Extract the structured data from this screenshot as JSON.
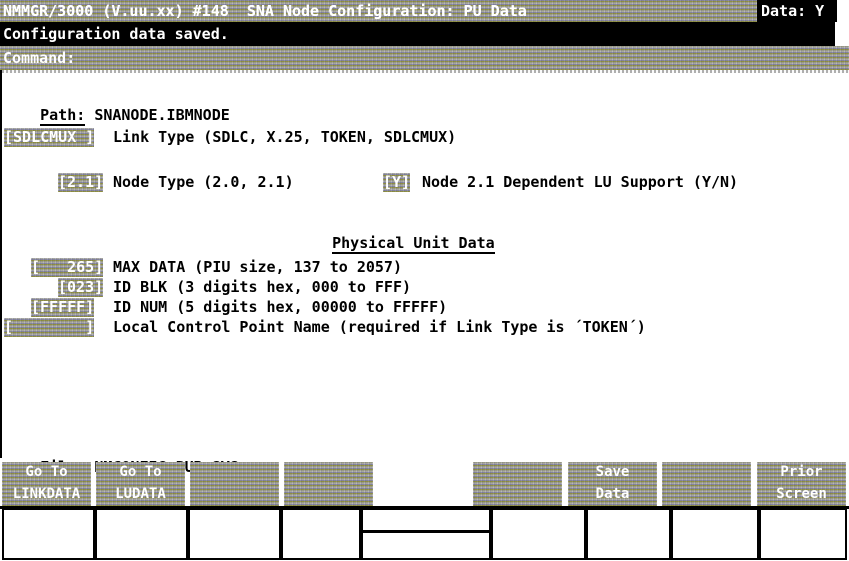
{
  "titlebar": {
    "text": "NMMGR/3000 (V.uu.xx) #148  SNA Node Configuration: PU Data",
    "data_indicator": "Data: Y"
  },
  "status": {
    "message": "Configuration data saved."
  },
  "command": {
    "label": "Command:",
    "value": ""
  },
  "path": {
    "label": "Path:",
    "value": "SNANODE.IBMNODE"
  },
  "form": {
    "link_type": {
      "field_value": "[SDLCMUX ]",
      "label": "Link Type (SDLC, X.25, TOKEN, SDLCMUX)"
    },
    "node_type": {
      "field_value": "[2.1]",
      "label": "Node Type (2.0, 2.1)"
    },
    "dependent_lu": {
      "field_value": "[Y]",
      "label": "Node 2.1 Dependent LU Support (Y/N)"
    },
    "section_heading": "Physical Unit Data",
    "max_data": {
      "field_value": "[   265]",
      "label": "MAX DATA (PIU size, 137 to 2057)"
    },
    "id_blk": {
      "field_value": "[023]",
      "label": "ID BLK (3 digits hex, 000 to FFF)"
    },
    "id_num": {
      "field_value": "[FFFFF]",
      "label": "ID NUM (5 digits hex, 00000 to FFFFF)"
    },
    "local_cp_name": {
      "field_value": "[        ]",
      "label": "Local Control Point Name (required if Link Type is ´TOKEN´)"
    }
  },
  "file": {
    "label": "File:",
    "value": "NMCONFIG.PUB.SYS"
  },
  "function_keys": [
    {
      "line1": "Go To",
      "line2": "LINKDATA"
    },
    {
      "line1": "Go To",
      "line2": "LUDATA"
    },
    {
      "line1": "",
      "line2": ""
    },
    {
      "line1": "",
      "line2": ""
    },
    {
      "line1": "",
      "line2": ""
    },
    {
      "line1": "Save",
      "line2": "Data"
    },
    {
      "line1": "",
      "line2": ""
    },
    {
      "line1": "Prior",
      "line2": "Screen"
    }
  ],
  "bottom_boxes": [
    {
      "label": ""
    },
    {
      "label": ""
    },
    {
      "label": ""
    },
    {
      "label": ""
    },
    {
      "label": "",
      "split": true
    },
    {
      "label": ""
    },
    {
      "label": ""
    },
    {
      "label": ""
    }
  ],
  "colors": {
    "background": "#ffffff",
    "foreground": "#000000",
    "inverse_background": "#000000",
    "inverse_foreground": "#ffffff",
    "field_texture": "#a0a0a0"
  }
}
